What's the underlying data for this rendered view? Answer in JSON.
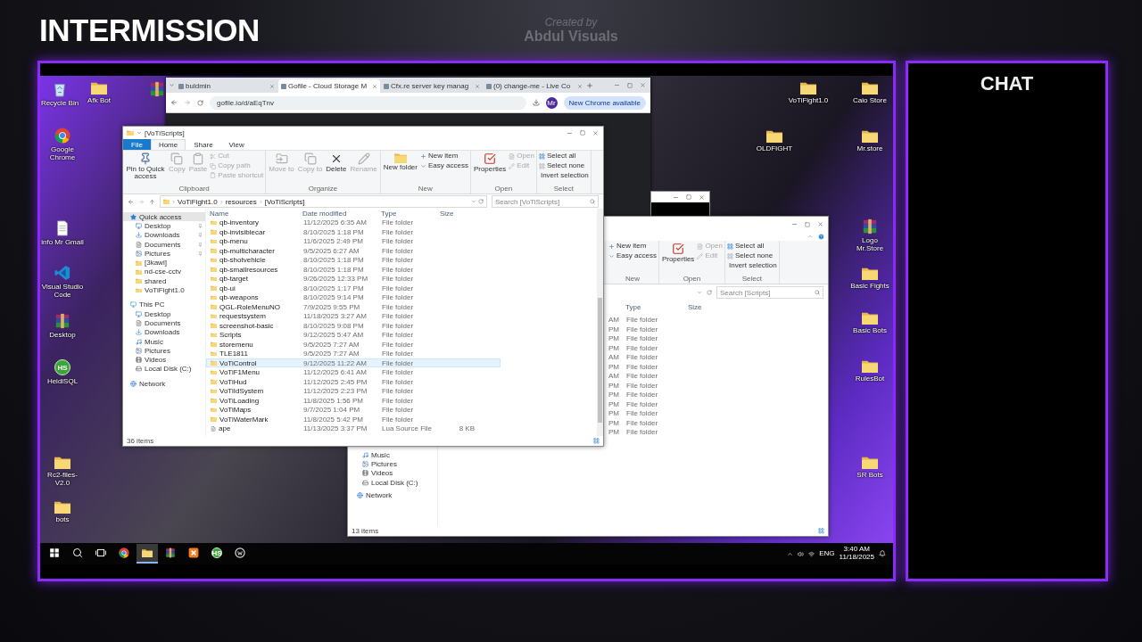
{
  "overlay": {
    "title": "INTERMISSION",
    "credit": [
      "Created by",
      "Abdul Visuals"
    ],
    "chat_title": "CHAT"
  },
  "desktop_icons_left": [
    {
      "label": "Recycle Bin",
      "kind": "bin"
    },
    {
      "label": "Afk Bot",
      "kind": "folder"
    },
    {
      "kind": "archive"
    },
    {
      "label": "Google Chrome",
      "kind": "chrome"
    },
    {
      "label": "info Mr Gmail",
      "kind": "doc"
    },
    {
      "label": "Visual Studio Code",
      "kind": "vscode"
    },
    {
      "label": "Desktop",
      "kind": "archive"
    },
    {
      "label": "HeidiSQL",
      "kind": "heidi",
      "badge": "HS"
    },
    {
      "label": "Rc2-files-V2.0",
      "kind": "folder"
    },
    {
      "label": "bots",
      "kind": "folder"
    }
  ],
  "desktop_icons_right": [
    {
      "label": "VoTiFight1.0",
      "kind": "folder"
    },
    {
      "label": "Caio Store",
      "kind": "folder"
    },
    {
      "label": "OLDFIGHT",
      "kind": "folder"
    },
    {
      "label": "Mr.store",
      "kind": "folder"
    },
    {
      "label": "Logo Mr.Store",
      "kind": "archive"
    },
    {
      "label": "Basic Fights",
      "kind": "folder"
    },
    {
      "label": "Basic Bots",
      "kind": "folder"
    },
    {
      "label": "RulesBot",
      "kind": "folder"
    },
    {
      "label": "SR Bots",
      "kind": "folder"
    }
  ],
  "browser": {
    "tabs": [
      {
        "title": "buldmin",
        "selected": false
      },
      {
        "title": "Gofile - Cloud Storage M",
        "selected": true
      },
      {
        "title": "Cfx.re server key manag",
        "selected": false
      },
      {
        "title": "(0) change-me - Live Co",
        "selected": false
      }
    ],
    "address": "gofile.io/d/aEqTnv",
    "profile": "Mr",
    "update_button": "New Chrome available"
  },
  "explorer": {
    "title": "[VoTiScripts]",
    "tabs": [
      {
        "label": "File",
        "kind": "file",
        "selected": false
      },
      {
        "label": "Home",
        "kind": "tab",
        "selected": true
      },
      {
        "label": "Share",
        "kind": "tab",
        "selected": false
      },
      {
        "label": "View",
        "kind": "tab",
        "selected": false
      }
    ],
    "ribbon": [
      {
        "group": "Clipboard",
        "items": [
          {
            "label": "Pin to Quick access",
            "kind": "large",
            "disabled": false
          },
          {
            "label": "Copy",
            "kind": "large",
            "disabled": true
          },
          {
            "label": "Paste",
            "kind": "large",
            "disabled": true
          },
          {
            "label": "Cut",
            "kind": "small",
            "disabled": true
          },
          {
            "label": "Copy path",
            "kind": "small",
            "disabled": true
          },
          {
            "label": "Paste shortcut",
            "kind": "small",
            "disabled": true
          }
        ]
      },
      {
        "group": "Organize",
        "items": [
          {
            "label": "Move to",
            "kind": "large",
            "disabled": true
          },
          {
            "label": "Copy to",
            "kind": "large",
            "disabled": true
          },
          {
            "label": "Delete",
            "kind": "large",
            "disabled": false
          },
          {
            "label": "Rename",
            "kind": "large",
            "disabled": true
          }
        ]
      },
      {
        "group": "New",
        "items": [
          {
            "label": "New folder",
            "kind": "large",
            "disabled": false
          },
          {
            "label": "New item",
            "kind": "small",
            "disabled": false
          },
          {
            "label": "Easy access",
            "kind": "small",
            "disabled": false
          }
        ]
      },
      {
        "group": "Open",
        "items": [
          {
            "label": "Properties",
            "kind": "large",
            "disabled": false
          },
          {
            "label": "Open",
            "kind": "small",
            "disabled": true
          },
          {
            "label": "Edit",
            "kind": "small",
            "disabled": true
          }
        ]
      },
      {
        "group": "Select",
        "items": [
          {
            "label": "Select all",
            "kind": "small",
            "disabled": false
          },
          {
            "label": "Select none",
            "kind": "small",
            "disabled": false
          },
          {
            "label": "Invert selection",
            "kind": "small",
            "disabled": false
          }
        ]
      }
    ],
    "path": [
      "VoTiFight1.0",
      "resources",
      "[VoTiScripts]"
    ],
    "search": {
      "placeholder": "Search [VoTiScripts]"
    },
    "nav": [
      {
        "label": "Quick access",
        "kind": "star",
        "selected": true,
        "children": [
          {
            "label": "Desktop",
            "kind": "desktop",
            "pinned": true
          },
          {
            "label": "Downloads",
            "kind": "download",
            "pinned": true
          },
          {
            "label": "Documents",
            "kind": "document",
            "pinned": true
          },
          {
            "label": "Pictures",
            "kind": "picture",
            "pinned": true
          },
          {
            "label": "[3kawi]",
            "kind": "folder",
            "pinned": false
          },
          {
            "label": "nd-cse-cctv",
            "kind": "folder",
            "pinned": false
          },
          {
            "label": "shared",
            "kind": "folder",
            "pinned": false
          },
          {
            "label": "VoTiFight1.0",
            "kind": "folder",
            "pinned": false
          }
        ]
      },
      {
        "label": "This PC",
        "kind": "pc",
        "selected": false,
        "children": [
          {
            "label": "Desktop",
            "kind": "desktop",
            "pinned": false
          },
          {
            "label": "Documents",
            "kind": "document",
            "pinned": false
          },
          {
            "label": "Downloads",
            "kind": "download",
            "pinned": false
          },
          {
            "label": "Music",
            "kind": "music",
            "pinned": false
          },
          {
            "label": "Pictures",
            "kind": "picture",
            "pinned": false
          },
          {
            "label": "Videos",
            "kind": "video",
            "pinned": false
          },
          {
            "label": "Local Disk (C:)",
            "kind": "disk",
            "pinned": false
          }
        ]
      },
      {
        "label": "Network",
        "kind": "network",
        "selected": false
      }
    ],
    "columns": [
      "Name",
      "Date modified",
      "Type",
      "Size"
    ],
    "rows": [
      {
        "name": "qb-inventory",
        "date": "11/12/2025 6:35 AM",
        "type": "File folder",
        "kind": "folder",
        "selected": false
      },
      {
        "name": "qb-invisiblecar",
        "date": "8/10/2025 1:18 PM",
        "type": "File folder",
        "kind": "folder",
        "selected": false
      },
      {
        "name": "qb-menu",
        "date": "11/6/2025 2:49 PM",
        "type": "File folder",
        "kind": "folder",
        "selected": false
      },
      {
        "name": "qb-multicharacter",
        "date": "9/5/2025 6:27 AM",
        "type": "File folder",
        "kind": "folder",
        "selected": false
      },
      {
        "name": "qb-shotvehicle",
        "date": "8/10/2025 1:18 PM",
        "type": "File folder",
        "kind": "folder",
        "selected": false
      },
      {
        "name": "qb-smallresources",
        "date": "8/10/2025 1:18 PM",
        "type": "File folder",
        "kind": "folder",
        "selected": false
      },
      {
        "name": "qb-target",
        "date": "9/26/2025 12:33 PM",
        "type": "File folder",
        "kind": "folder",
        "selected": false
      },
      {
        "name": "qb-ui",
        "date": "8/10/2025 1:17 PM",
        "type": "File folder",
        "kind": "folder",
        "selected": false
      },
      {
        "name": "qb-weapons",
        "date": "8/10/2025 9:14 PM",
        "type": "File folder",
        "kind": "folder",
        "selected": false
      },
      {
        "name": "QGL-RoleMenuNO",
        "date": "7/9/2025 9:55 PM",
        "type": "File folder",
        "kind": "folder",
        "selected": false
      },
      {
        "name": "requestsystem",
        "date": "11/18/2025 3:27 AM",
        "type": "File folder",
        "kind": "folder",
        "selected": false
      },
      {
        "name": "screenshot-basic",
        "date": "8/10/2025 9:08 PM",
        "type": "File folder",
        "kind": "folder",
        "selected": false
      },
      {
        "name": "Scripts",
        "date": "9/12/2025 5:47 AM",
        "type": "File folder",
        "kind": "folder",
        "selected": false
      },
      {
        "name": "storemenu",
        "date": "9/5/2025 7:27 AM",
        "type": "File folder",
        "kind": "folder",
        "selected": false
      },
      {
        "name": "TLE1811",
        "date": "9/5/2025 7:27 AM",
        "type": "File folder",
        "kind": "folder",
        "selected": false
      },
      {
        "name": "VoTiControl",
        "date": "9/12/2025 11:22 AM",
        "type": "File folder",
        "kind": "folder",
        "selected": true
      },
      {
        "name": "VoTiF1Menu",
        "date": "11/12/2025 6:41 AM",
        "type": "File folder",
        "kind": "folder",
        "selected": false
      },
      {
        "name": "VoTiHud",
        "date": "11/12/2025 2:45 PM",
        "type": "File folder",
        "kind": "folder",
        "selected": false
      },
      {
        "name": "VoTiIdSystem",
        "date": "11/12/2025 2:23 PM",
        "type": "File folder",
        "kind": "folder",
        "selected": false
      },
      {
        "name": "VoTiLoading",
        "date": "11/8/2025 1:56 PM",
        "type": "File folder",
        "kind": "folder",
        "selected": false
      },
      {
        "name": "VoTiMaps",
        "date": "9/7/2025 1:04 PM",
        "type": "File folder",
        "kind": "folder",
        "selected": false
      },
      {
        "name": "VoTiWaterMark",
        "date": "11/8/2025 5:42 PM",
        "type": "File folder",
        "kind": "folder",
        "selected": false
      },
      {
        "name": "ape",
        "date": "11/13/2025 3:37 PM",
        "type": "Lua Source File",
        "size": "8 KB",
        "kind": "file",
        "selected": false
      }
    ],
    "status": "36 items"
  },
  "explorer_back": {
    "ribbon": [
      {
        "group": "New",
        "items": [
          {
            "label": "New item",
            "kind": "small",
            "disabled": false
          },
          {
            "label": "Easy access",
            "kind": "small",
            "disabled": false
          }
        ]
      },
      {
        "group": "Open",
        "items": [
          {
            "label": "Properties",
            "kind": "large",
            "disabled": false
          },
          {
            "label": "Open",
            "kind": "small",
            "disabled": true
          },
          {
            "label": "Edit",
            "kind": "small",
            "disabled": true
          }
        ]
      },
      {
        "group": "Select",
        "items": [
          {
            "label": "Select all",
            "kind": "small",
            "disabled": false
          },
          {
            "label": "Select none",
            "kind": "small",
            "disabled": false
          },
          {
            "label": "Invert selection",
            "kind": "small",
            "disabled": false
          }
        ]
      }
    ],
    "search": {
      "placeholder": "Search [Scripts]"
    },
    "columns": [
      "Type",
      "Size"
    ],
    "rows": [
      {
        "date": "AM",
        "type": "File folder"
      },
      {
        "date": "PM",
        "type": "File folder"
      },
      {
        "date": "PM",
        "type": "File folder"
      },
      {
        "date": "PM",
        "type": "File folder"
      },
      {
        "date": "AM",
        "type": "File folder"
      },
      {
        "date": "PM",
        "type": "File folder"
      },
      {
        "date": "AM",
        "type": "File folder"
      },
      {
        "date": "PM",
        "type": "File folder"
      },
      {
        "date": "PM",
        "type": "File folder"
      },
      {
        "date": "PM",
        "type": "File folder"
      },
      {
        "date": "PM",
        "type": "File folder"
      },
      {
        "date": "PM",
        "type": "File folder"
      },
      {
        "date": "PM",
        "type": "File folder"
      }
    ],
    "nav": [
      {
        "label": "Music",
        "kind": "music"
      },
      {
        "label": "Pictures",
        "kind": "picture"
      },
      {
        "label": "Videos",
        "kind": "video"
      },
      {
        "label": "Local Disk (C:)",
        "kind": "disk"
      },
      {
        "label": "Network",
        "kind": "network"
      }
    ],
    "status": "13 items"
  },
  "taskbar": {
    "apps": [
      {
        "kind": "start",
        "selected": false
      },
      {
        "kind": "search",
        "selected": false
      },
      {
        "kind": "taskview",
        "selected": false
      },
      {
        "kind": "chrome",
        "selected": false
      },
      {
        "kind": "explorer",
        "selected": true
      },
      {
        "kind": "archive",
        "selected": false
      },
      {
        "kind": "xampp",
        "selected": false
      },
      {
        "kind": "heidi",
        "selected": false,
        "badge": "HS"
      },
      {
        "kind": "app",
        "selected": false
      }
    ],
    "language": "ENG",
    "time": "3:40 AM",
    "date": "11/18/2025"
  }
}
